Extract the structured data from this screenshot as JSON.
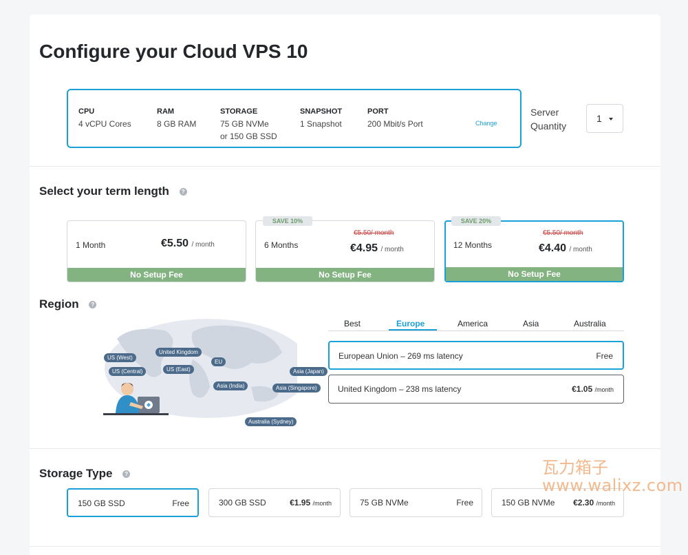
{
  "page": {
    "title": "Configure your Cloud VPS 10"
  },
  "specs": [
    {
      "label": "CPU",
      "value": "4 vCPU Cores"
    },
    {
      "label": "RAM",
      "value": "8 GB RAM"
    },
    {
      "label": "STORAGE",
      "value": "75 GB NVMe",
      "value2": "or 150 GB SSD"
    },
    {
      "label": "SNAPSHOT",
      "value": "1 Snapshot"
    },
    {
      "label": "PORT",
      "value": "200 Mbit/s Port"
    }
  ],
  "change_label": "Change",
  "quantity": {
    "label": "Server Quantity",
    "value": "1"
  },
  "term": {
    "heading": "Select your term length",
    "help": "?",
    "options": [
      {
        "name": "1 Month",
        "price": "€5.50",
        "per": "/ month",
        "fee": "No Setup Fee"
      },
      {
        "badge": "SAVE 10%",
        "name": "6 Months",
        "old": "€5.50/ month",
        "price": "€4.95",
        "per": "/ month",
        "fee": "No Setup Fee"
      },
      {
        "badge": "SAVE 20%",
        "name": "12 Months",
        "old": "€5.50/ month",
        "price": "€4.40",
        "per": "/ month",
        "fee": "No Setup Fee",
        "selected": true
      }
    ]
  },
  "region": {
    "heading": "Region",
    "help": "?",
    "map_labels": [
      "US (West)",
      "United Kingdom",
      "US (Central)",
      "US (East)",
      "EU",
      "Asia (Japan)",
      "Asia (India)",
      "Asia (Singapore)",
      "Australia (Sydney)"
    ],
    "tabs": [
      "Best",
      "Europe",
      "America",
      "Asia",
      "Australia"
    ],
    "active_tab": "Europe",
    "options": [
      {
        "name": "European Union – 269 ms latency",
        "price": "Free",
        "selected": true
      },
      {
        "name": "United Kingdom – 238 ms latency",
        "price": "€1.05",
        "per": "/month"
      }
    ]
  },
  "storage": {
    "heading": "Storage Type",
    "help": "?",
    "options": [
      {
        "name": "150 GB SSD",
        "price": "Free",
        "selected": true
      },
      {
        "name": "300 GB SSD",
        "price": "€1.95",
        "per": "/month"
      },
      {
        "name": "75 GB NVMe",
        "price": "Free"
      },
      {
        "name": "150 GB NVMe",
        "price": "€2.30",
        "per": "/month"
      }
    ]
  },
  "watermark": {
    "line1": "瓦力箱子",
    "line2": "www.walixz.com"
  },
  "colors": {
    "accent": "#1aa0d8",
    "fee_bar": "#84b382",
    "strike": "#c94040",
    "map_tag": "#4c6b8a"
  }
}
